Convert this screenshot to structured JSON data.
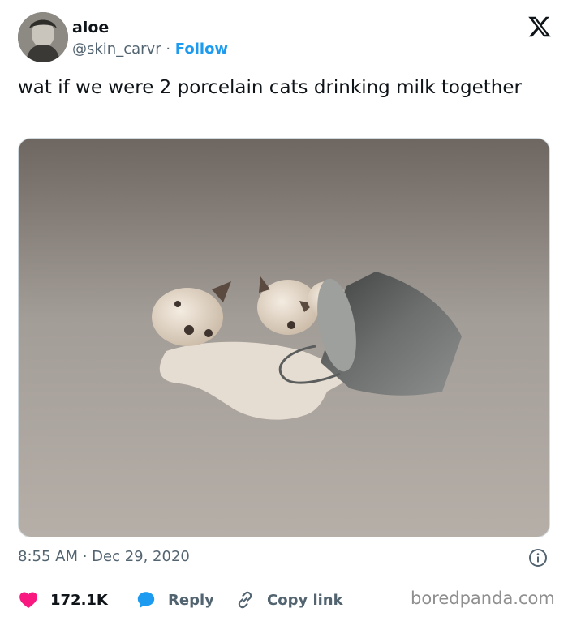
{
  "author": {
    "name": "aloe",
    "handle": "@skin_carvr",
    "separator": "·",
    "follow_label": "Follow"
  },
  "brand_icon": "x-logo",
  "tweet": {
    "text": "wat if we were 2 porcelain cats drinking milk together",
    "image_icon": "porcelain-cats-photo",
    "timestamp": "8:55 AM · Dec 29, 2020"
  },
  "actions": {
    "likes_count": "172.1K",
    "reply_label": "Reply",
    "copy_link_label": "Copy link"
  },
  "watermark": "boredpanda.com",
  "colors": {
    "accent": "#1d9bf0",
    "like": "#f91880",
    "muted": "#536471",
    "text": "#0f1419"
  }
}
